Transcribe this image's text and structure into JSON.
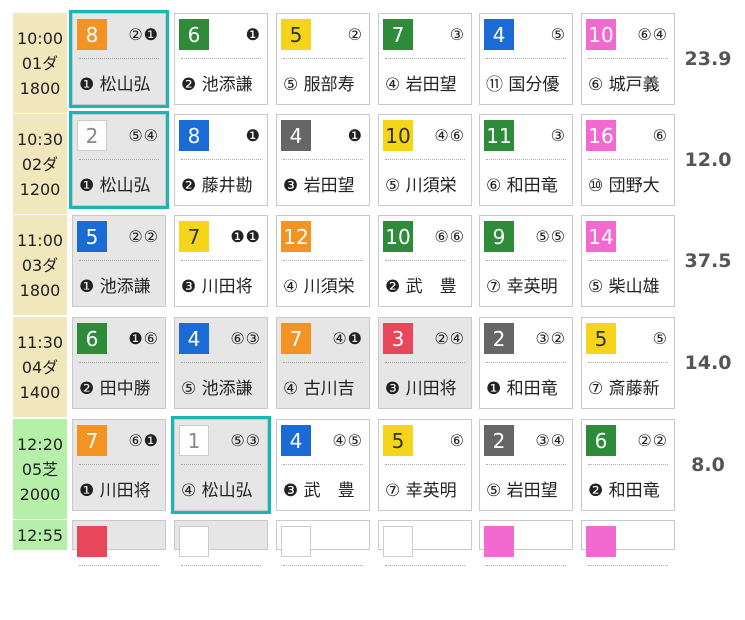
{
  "races": [
    {
      "time": "10:00",
      "race": "01ダ",
      "distance": "1800",
      "surface": "dirt",
      "odds": "23.9",
      "entries": [
        {
          "num": "8",
          "color": "#f39324",
          "marks": "②❶",
          "jockey": "❶ 松山弘",
          "shaded": true,
          "selected": true
        },
        {
          "num": "6",
          "color": "#2e8b3a",
          "marks": "❶",
          "jockey": "❷ 池添謙",
          "shaded": false,
          "selected": false
        },
        {
          "num": "5",
          "color": "#f4d519",
          "marks": "②",
          "jockey": "⑤ 服部寿",
          "shaded": false,
          "selected": false
        },
        {
          "num": "7",
          "color": "#2e8b3a",
          "marks": "③",
          "jockey": "④ 岩田望",
          "shaded": false,
          "selected": false
        },
        {
          "num": "4",
          "color": "#1a6bd6",
          "marks": "⑤",
          "jockey": "⑪ 国分優",
          "shaded": false,
          "selected": false
        },
        {
          "num": "10",
          "color": "#f26ad0",
          "marks": "⑥④",
          "jockey": "⑥ 城戸義",
          "shaded": false,
          "selected": false
        }
      ]
    },
    {
      "time": "10:30",
      "race": "02ダ",
      "distance": "1200",
      "surface": "dirt",
      "odds": "12.0",
      "entries": [
        {
          "num": "2",
          "color": "#ffffff",
          "marks": "⑤④",
          "jockey": "❶ 松山弘",
          "shaded": true,
          "selected": true
        },
        {
          "num": "8",
          "color": "#1a6bd6",
          "marks": "❶",
          "jockey": "❷ 藤井勘",
          "shaded": false,
          "selected": false
        },
        {
          "num": "4",
          "color": "#666666",
          "marks": "❶",
          "jockey": "❸ 岩田望",
          "shaded": false,
          "selected": false
        },
        {
          "num": "10",
          "color": "#f4d519",
          "marks": "④⑥",
          "jockey": "⑤ 川須栄",
          "shaded": false,
          "selected": false
        },
        {
          "num": "11",
          "color": "#2e8b3a",
          "marks": "③",
          "jockey": "⑥ 和田竜",
          "shaded": false,
          "selected": false
        },
        {
          "num": "16",
          "color": "#f26ad0",
          "marks": "⑥",
          "jockey": "⑩ 団野大",
          "shaded": false,
          "selected": false
        }
      ]
    },
    {
      "time": "11:00",
      "race": "03ダ",
      "distance": "1800",
      "surface": "dirt",
      "odds": "37.5",
      "entries": [
        {
          "num": "5",
          "color": "#1a6bd6",
          "marks": "②②",
          "jockey": "❶ 池添謙",
          "shaded": true,
          "selected": false
        },
        {
          "num": "7",
          "color": "#f4d519",
          "marks": "❶❶",
          "jockey": "❸ 川田将",
          "shaded": false,
          "selected": false
        },
        {
          "num": "12",
          "color": "#f39324",
          "marks": "",
          "jockey": "④ 川須栄",
          "shaded": false,
          "selected": false
        },
        {
          "num": "10",
          "color": "#2e8b3a",
          "marks": "⑥⑥",
          "jockey": "❷ 武　豊",
          "shaded": false,
          "selected": false
        },
        {
          "num": "9",
          "color": "#2e8b3a",
          "marks": "⑤⑤",
          "jockey": "⑦ 幸英明",
          "shaded": false,
          "selected": false
        },
        {
          "num": "14",
          "color": "#f26ad0",
          "marks": "",
          "jockey": "⑤ 柴山雄",
          "shaded": false,
          "selected": false
        }
      ]
    },
    {
      "time": "11:30",
      "race": "04ダ",
      "distance": "1400",
      "surface": "dirt",
      "odds": "14.0",
      "entries": [
        {
          "num": "6",
          "color": "#2e8b3a",
          "marks": "❶⑥",
          "jockey": "❷ 田中勝",
          "shaded": true,
          "selected": false
        },
        {
          "num": "4",
          "color": "#1a6bd6",
          "marks": "⑥③",
          "jockey": "⑤ 池添謙",
          "shaded": true,
          "selected": false
        },
        {
          "num": "7",
          "color": "#f39324",
          "marks": "④❶",
          "jockey": "④ 古川吉",
          "shaded": true,
          "selected": false
        },
        {
          "num": "3",
          "color": "#e8465b",
          "marks": "②④",
          "jockey": "❸ 川田将",
          "shaded": true,
          "selected": false
        },
        {
          "num": "2",
          "color": "#666666",
          "marks": "③②",
          "jockey": "❶ 和田竜",
          "shaded": false,
          "selected": false
        },
        {
          "num": "5",
          "color": "#f4d519",
          "marks": "⑤",
          "jockey": "⑦ 斎藤新",
          "shaded": false,
          "selected": false
        }
      ]
    },
    {
      "time": "12:20",
      "race": "05芝",
      "distance": "2000",
      "surface": "turf",
      "odds": "8.0",
      "entries": [
        {
          "num": "7",
          "color": "#f39324",
          "marks": "⑥❶",
          "jockey": "❶ 川田将",
          "shaded": true,
          "selected": false
        },
        {
          "num": "1",
          "color": "#ffffff",
          "marks": "⑤③",
          "jockey": "④ 松山弘",
          "shaded": true,
          "selected": true
        },
        {
          "num": "4",
          "color": "#1a6bd6",
          "marks": "④⑤",
          "jockey": "❸ 武　豊",
          "shaded": false,
          "selected": false
        },
        {
          "num": "5",
          "color": "#f4d519",
          "marks": "⑥",
          "jockey": "⑦ 幸英明",
          "shaded": false,
          "selected": false
        },
        {
          "num": "2",
          "color": "#666666",
          "marks": "③④",
          "jockey": "⑤ 岩田望",
          "shaded": false,
          "selected": false
        },
        {
          "num": "6",
          "color": "#2e8b3a",
          "marks": "②②",
          "jockey": "❷ 和田竜",
          "shaded": false,
          "selected": false
        }
      ]
    },
    {
      "time": "12:55",
      "race": "",
      "distance": "",
      "surface": "turf",
      "odds": "",
      "entries": [
        {
          "num": "",
          "color": "#e8465b",
          "marks": "",
          "jockey": "",
          "shaded": true,
          "selected": false
        },
        {
          "num": "",
          "color": "#ffffff",
          "marks": "",
          "jockey": "",
          "shaded": true,
          "selected": false
        },
        {
          "num": "",
          "color": "#ffffff",
          "marks": "",
          "jockey": "",
          "shaded": false,
          "selected": false
        },
        {
          "num": "",
          "color": "#ffffff",
          "marks": "",
          "jockey": "",
          "shaded": false,
          "selected": false
        },
        {
          "num": "",
          "color": "#f26ad0",
          "marks": "",
          "jockey": "",
          "shaded": false,
          "selected": false
        },
        {
          "num": "",
          "color": "#f26ad0",
          "marks": "",
          "jockey": "",
          "shaded": false,
          "selected": false
        }
      ]
    }
  ]
}
